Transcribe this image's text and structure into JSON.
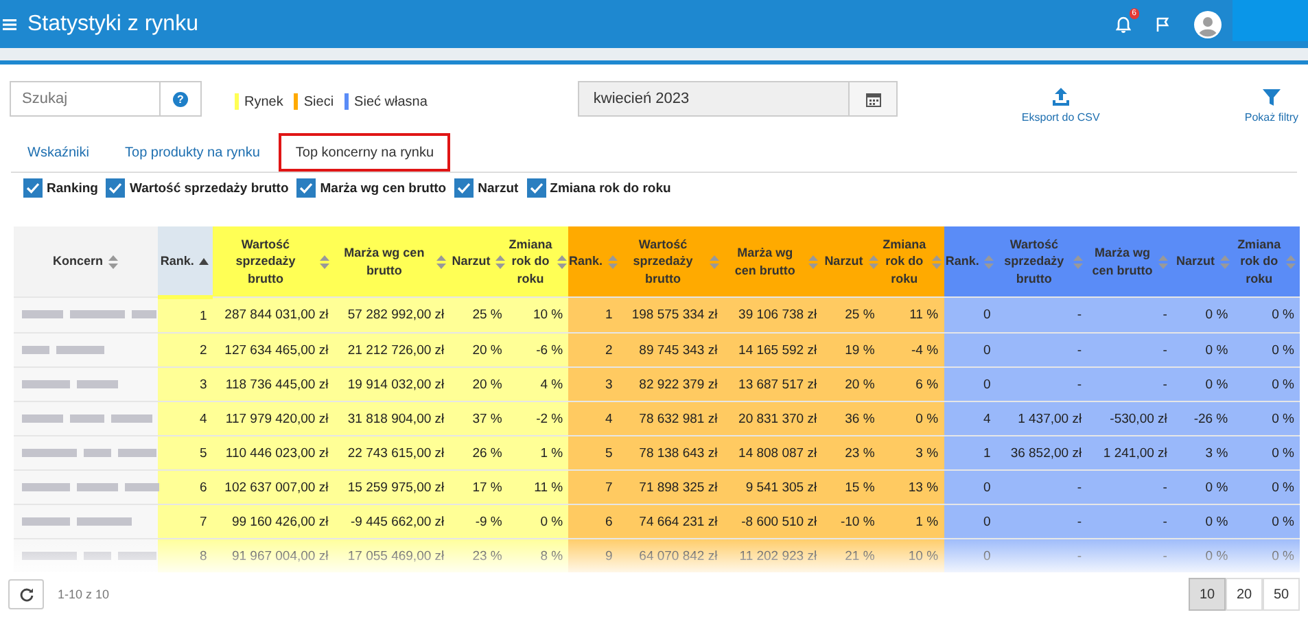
{
  "app_bar": {
    "title": "Statystyki z rynku",
    "notification_count": "6"
  },
  "search": {
    "placeholder": "Szukaj",
    "help_icon": "?"
  },
  "legend": [
    {
      "label": "Rynek",
      "color": "#ffff55"
    },
    {
      "label": "Sieci",
      "color": "#ffaa00"
    },
    {
      "label": "Sieć własna",
      "color": "#5a8cf7"
    }
  ],
  "period": {
    "value": "kwiecień 2023"
  },
  "actions": [
    {
      "label": "Eksport do CSV",
      "kind": "export"
    },
    {
      "label": "Pokaż filtry",
      "kind": "filter"
    }
  ],
  "tabs": [
    {
      "label": "Wskaźniki",
      "selected": false
    },
    {
      "label": "Top produkty na rynku",
      "selected": false
    },
    {
      "label": "Top koncerny na rynku",
      "selected": true
    }
  ],
  "column_toggles": [
    {
      "label": "Ranking",
      "checked": true
    },
    {
      "label": "Wartość sprzedaży brutto",
      "checked": true
    },
    {
      "label": "Marża wg cen brutto",
      "checked": true
    },
    {
      "label": "Narzut",
      "checked": true
    },
    {
      "label": "Zmiana rok do roku",
      "checked": true
    }
  ],
  "table": {
    "columns": [
      {
        "label": "Koncern",
        "sorted": false
      },
      {
        "label": "Rank.",
        "color": "#ffff55",
        "sorted": true
      },
      {
        "label": "Wartość sprzedaży brutto",
        "color": "#ffff55",
        "sorted": false
      },
      {
        "label": "Marża wg cen brutto",
        "color": "#ffff55",
        "sorted": false
      },
      {
        "label": "Narzut",
        "color": "#ffff55",
        "sorted": false
      },
      {
        "label": "Zmiana rok do roku",
        "color": "#ffff55",
        "sorted": false
      },
      {
        "label": "Rank.",
        "color": "#ffaa00",
        "sorted": false
      },
      {
        "label": "Wartość sprzedaży brutto",
        "color": "#ffaa00",
        "sorted": false
      },
      {
        "label": "Marża wg cen brutto",
        "color": "#ffaa00",
        "sorted": false
      },
      {
        "label": "Narzut",
        "color": "#ffaa00",
        "sorted": false
      },
      {
        "label": "Zmiana rok do roku",
        "color": "#ffaa00",
        "sorted": false
      },
      {
        "label": "Rank.",
        "color": "#5a8cf7",
        "sorted": false
      },
      {
        "label": "Wartość sprzedaży brutto",
        "color": "#5a8cf7",
        "sorted": false
      },
      {
        "label": "Marża wg cen brutto",
        "color": "#5a8cf7",
        "sorted": false
      },
      {
        "label": "Narzut",
        "color": "#5a8cf7",
        "sorted": false
      },
      {
        "label": "Zmiana rok do roku",
        "color": "#5a8cf7",
        "sorted": false
      }
    ],
    "rows": [
      {
        "cells": [
          "",
          "1",
          "287 844 031,00 zł",
          "57 282 992,00 zł",
          "25 %",
          "10 %",
          "1",
          "198 575 334 zł",
          "39 106 738 zł",
          "25 %",
          "11 %",
          "0",
          "-",
          "-",
          "0 %",
          "0 %"
        ]
      },
      {
        "cells": [
          "",
          "2",
          "127 634 465,00 zł",
          "21 212 726,00 zł",
          "20 %",
          "-6 %",
          "2",
          "89 745 343 zł",
          "14 165 592 zł",
          "19 %",
          "-4 %",
          "0",
          "-",
          "-",
          "0 %",
          "0 %"
        ]
      },
      {
        "cells": [
          "",
          "3",
          "118 736 445,00 zł",
          "19 914 032,00 zł",
          "20 %",
          "4 %",
          "3",
          "82 922 379 zł",
          "13 687 517 zł",
          "20 %",
          "6 %",
          "0",
          "-",
          "-",
          "0 %",
          "0 %"
        ]
      },
      {
        "cells": [
          "",
          "4",
          "117 979 420,00 zł",
          "31 818 904,00 zł",
          "37 %",
          "-2 %",
          "4",
          "78 632 981 zł",
          "20 831 370 zł",
          "36 %",
          "0 %",
          "4",
          "1 437,00 zł",
          "-530,00 zł",
          "-26 %",
          "0 %"
        ]
      },
      {
        "cells": [
          "",
          "5",
          "110 446 023,00 zł",
          "22 743 615,00 zł",
          "26 %",
          "1 %",
          "5",
          "78 138 643 zł",
          "14 808 087 zł",
          "23 %",
          "3 %",
          "1",
          "36 852,00 zł",
          "1 241,00 zł",
          "3 %",
          "0 %"
        ]
      },
      {
        "cells": [
          "",
          "6",
          "102 637 007,00 zł",
          "15 259 975,00 zł",
          "17 %",
          "11 %",
          "7",
          "71 898 325 zł",
          "9 541 305 zł",
          "15 %",
          "13 %",
          "0",
          "-",
          "-",
          "0 %",
          "0 %"
        ]
      },
      {
        "cells": [
          "",
          "7",
          "99 160 426,00 zł",
          "-9 445 662,00 zł",
          "-9 %",
          "0 %",
          "6",
          "74 664 231 zł",
          "-8 600 510 zł",
          "-10 %",
          "1 %",
          "0",
          "-",
          "-",
          "0 %",
          "0 %"
        ]
      },
      {
        "cells": [
          "",
          "8",
          "91 967 004,00 zł",
          "17 055 469,00 zł",
          "23 %",
          "8 %",
          "9",
          "64 070 842 zł",
          "11 202 923 zł",
          "21 %",
          "10 %",
          "0",
          "-",
          "-",
          "0 %",
          "0 %"
        ]
      }
    ]
  },
  "pagination": {
    "range": "1-10 z 10",
    "sizes": [
      {
        "label": "10",
        "selected": true
      },
      {
        "label": "20",
        "selected": false
      },
      {
        "label": "50",
        "selected": false
      }
    ]
  }
}
